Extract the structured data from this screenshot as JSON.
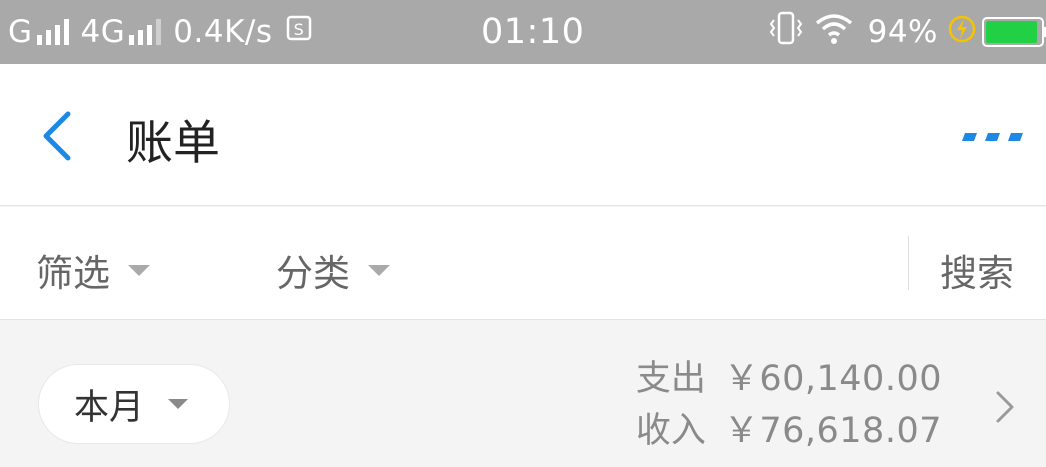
{
  "status_bar": {
    "carrier1": "G",
    "network": "4G",
    "speed": "0.4K/s",
    "time": "01:10",
    "battery_percent": "94%",
    "battery_color": "#21d045",
    "icons": [
      "signal-icon",
      "gallery-notification-icon",
      "vibrate-icon",
      "wifi-icon",
      "charging-icon",
      "battery-icon"
    ]
  },
  "header": {
    "title": "账单",
    "accent_color": "#1e88e5"
  },
  "filters": {
    "filter_label": "筛选",
    "category_label": "分类",
    "search_label": "搜索"
  },
  "summary": {
    "period_label": "本月",
    "expense_label": "支出",
    "expense_amount": "￥60,140.00",
    "income_label": "收入",
    "income_amount": "￥76,618.07"
  }
}
